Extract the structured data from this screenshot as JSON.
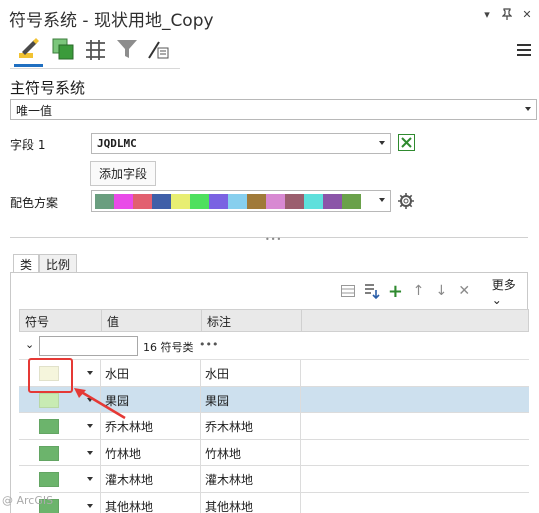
{
  "window": {
    "title": "符号系统 - 现状用地_Copy",
    "buttons": [
      "▾",
      "ᴘ",
      "×"
    ]
  },
  "toolbar": {
    "tools": [
      "primary-symbology-icon",
      "vary-symbology-icon",
      "label-class-icon",
      "filter-icon",
      "advanced-symbol-icon"
    ]
  },
  "primary": {
    "heading": "主符号系统",
    "method": "唯一值"
  },
  "field": {
    "label": "字段 1",
    "value": "JQDLMC",
    "add_button": "添加字段"
  },
  "color_scheme": {
    "label": "配色方案",
    "colors": [
      "#6a9e7f",
      "#e94be8",
      "#e26070",
      "#3f5fa8",
      "#e8ee72",
      "#4ee05e",
      "#7a62e2",
      "#87cfee",
      "#a07a3a",
      "#d889d2",
      "#9b5e6e",
      "#5ee0dc",
      "#8b55a8",
      "#6aa14a"
    ]
  },
  "tabs": {
    "classes": "类",
    "scale": "比例"
  },
  "grid_toolbar": {
    "more": "更多"
  },
  "grid": {
    "headers": {
      "symbol": "符号",
      "value": "值",
      "label": "标注"
    },
    "group_count": "16 符号类",
    "group_dots": "•••",
    "rows": [
      {
        "value": "水田",
        "label": "水田",
        "color": "#f5f5dc"
      },
      {
        "value": "果园",
        "label": "果园",
        "color": "#c8ebb3"
      },
      {
        "value": "乔木林地",
        "label": "乔木林地",
        "color": "#6cb46c"
      },
      {
        "value": "竹林地",
        "label": "竹林地",
        "color": "#6cb46c"
      },
      {
        "value": "灌木林地",
        "label": "灌木林地",
        "color": "#6cb46c"
      },
      {
        "value": "其他林地",
        "label": "其他林地",
        "color": "#6cb46c"
      }
    ]
  },
  "watermark": "@ ArcGIS"
}
